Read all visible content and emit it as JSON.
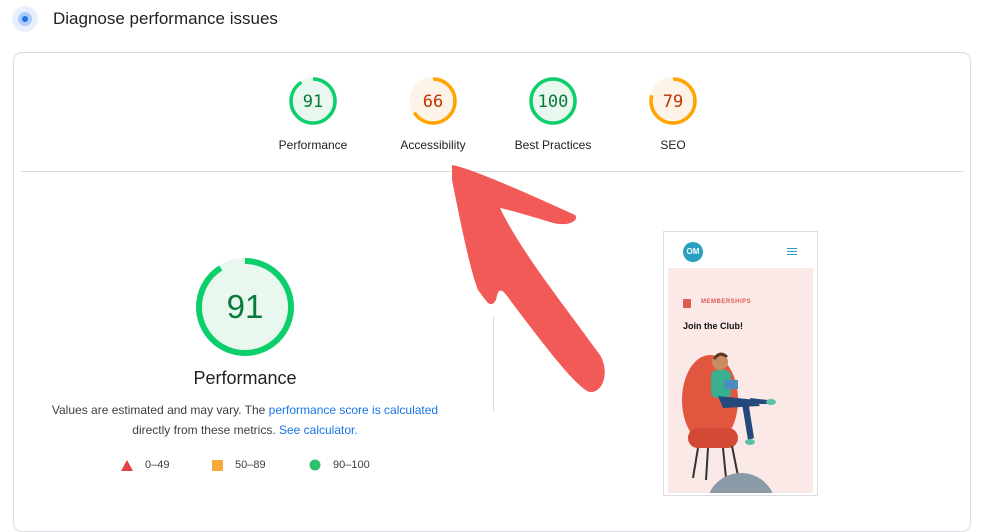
{
  "section": {
    "title": "Diagnose performance issues",
    "icon": "lighthouse-icon"
  },
  "categories": [
    {
      "label": "Performance",
      "score": "91",
      "value": 91,
      "color": "#0cce6b",
      "bg": "#e8f8ee",
      "textColor": "#0a7a3a"
    },
    {
      "label": "Accessibility",
      "score": "66",
      "value": 66,
      "color": "#ffa400",
      "bg": "#fdf3e6",
      "textColor": "#c33300"
    },
    {
      "label": "Best Practices",
      "score": "100",
      "value": 100,
      "color": "#0cce6b",
      "bg": "#e8f8ee",
      "textColor": "#0a7a3a"
    },
    {
      "label": "SEO",
      "score": "79",
      "value": 79,
      "color": "#ffa400",
      "bg": "#fdf3e6",
      "textColor": "#c33300"
    }
  ],
  "performance": {
    "score": "91",
    "value": 91,
    "title": "Performance",
    "desc_pre": "Values are estimated and may vary. The ",
    "desc_link1": "performance score is calculated",
    "desc_mid": "directly from these metrics. ",
    "desc_link2": "See calculator."
  },
  "legend": [
    {
      "range": "0–49",
      "shape": "triangle",
      "color": "#e34242"
    },
    {
      "range": "50–89",
      "shape": "square",
      "color": "#f4a939"
    },
    {
      "range": "90–100",
      "shape": "circle",
      "color": "#2fbf6a"
    }
  ],
  "preview": {
    "logo": "OM",
    "kicker": "MEMBERSHIPS",
    "headline": "Join the Club!",
    "menu_icon": "hamburger-icon"
  },
  "annotation": {
    "arrow_color": "#f25a58"
  }
}
